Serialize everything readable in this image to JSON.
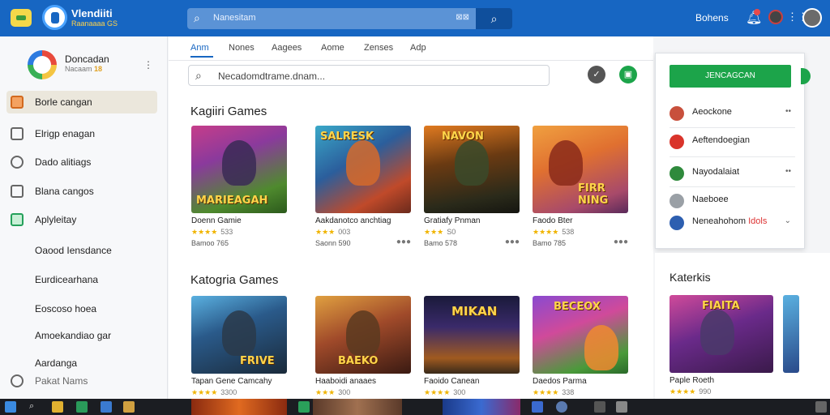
{
  "header": {
    "brand_name": "Vlendiiti",
    "brand_sub": "Raanaaaa GS",
    "search_placeholder": "Nanesitam",
    "search_kbd": "⊠⊠",
    "user_label": "Bohens"
  },
  "sidebar": {
    "profile": {
      "name": "Doncadan",
      "sub": "Nacaam",
      "badge": "18"
    },
    "items": [
      {
        "label": "Borle cangan",
        "active": true
      },
      {
        "label": "Elrigp enagan"
      },
      {
        "label": "Dado alitiags"
      },
      {
        "label": "Blana cangos"
      },
      {
        "label": "Aplyleitay"
      },
      {
        "label": "Oaood Iensdance"
      },
      {
        "label": "Eurdicearhana"
      },
      {
        "label": "Eoscoso hoea"
      },
      {
        "label": "Amoekandiao gar"
      },
      {
        "label": "Aardanga"
      },
      {
        "label": "Pakat Nams"
      }
    ]
  },
  "main": {
    "tabs": [
      "Anm",
      "Nones",
      "Aagees",
      "Aome",
      "Zenses",
      "Adp"
    ],
    "filter_placeholder": "Necadomdtrame.dnam...",
    "sections": [
      {
        "title": "Kagiiri Games",
        "cards": [
          {
            "title": "Doenn Gamie",
            "rating": "★★★★",
            "count": "533",
            "meta": "Bamoo 765",
            "caption": "MARIEAGAH"
          },
          {
            "title": "Aakdanotco anchtiag",
            "rating": "★★★",
            "count": "003",
            "meta": "Saonn 590",
            "caption": "SALRESK"
          },
          {
            "title": "Gratiafy Pnman",
            "rating": "★★★",
            "count": "S0",
            "meta": "Bamo 578",
            "caption": "NAVON"
          },
          {
            "title": "Faodo Bter",
            "rating": "★★★★",
            "count": "538",
            "meta": "Bamo 785",
            "caption": "FIRR NING"
          }
        ]
      },
      {
        "title": "Katogria Games",
        "cards": [
          {
            "title": "Tapan Gene Camcahy",
            "rating": "★★★★",
            "count": "3300",
            "meta": "",
            "caption": "FRIVE"
          },
          {
            "title": "Haaboidi anaaes",
            "rating": "★★★",
            "count": "300",
            "meta": "",
            "caption": "BAEKO"
          },
          {
            "title": "Faoido Canean",
            "rating": "★★★★",
            "count": "300",
            "meta": "",
            "caption": "MIKAN"
          },
          {
            "title": "Daedos Parma",
            "rating": "★★★★",
            "count": "338",
            "meta": "",
            "caption": "BECEOX"
          }
        ]
      }
    ]
  },
  "dropdown": {
    "button_label": "JENCAGCAN",
    "items": [
      {
        "label": "Aeockone",
        "badge": "",
        "color": "#c8503c"
      },
      {
        "label": "Aeftendoegian",
        "badge": "",
        "color": "#d9342b"
      },
      {
        "label": "Nayodalaiat",
        "badge": "",
        "color": "#2f8a3c"
      },
      {
        "label": "Naeboee",
        "badge": "",
        "color": "#9aa0a6"
      },
      {
        "label": "Neneahohom",
        "badge": "Idols",
        "color": "#2d5fb0"
      }
    ]
  },
  "right_panel": {
    "title": "Katerkis",
    "cards": [
      {
        "title": "Paple Roeth",
        "rating": "★★★★",
        "count": "990",
        "caption": "FIAITA"
      }
    ]
  },
  "colors": {
    "accent": "#1766c2",
    "cta": "#1ca44a",
    "star": "#f0b400"
  }
}
